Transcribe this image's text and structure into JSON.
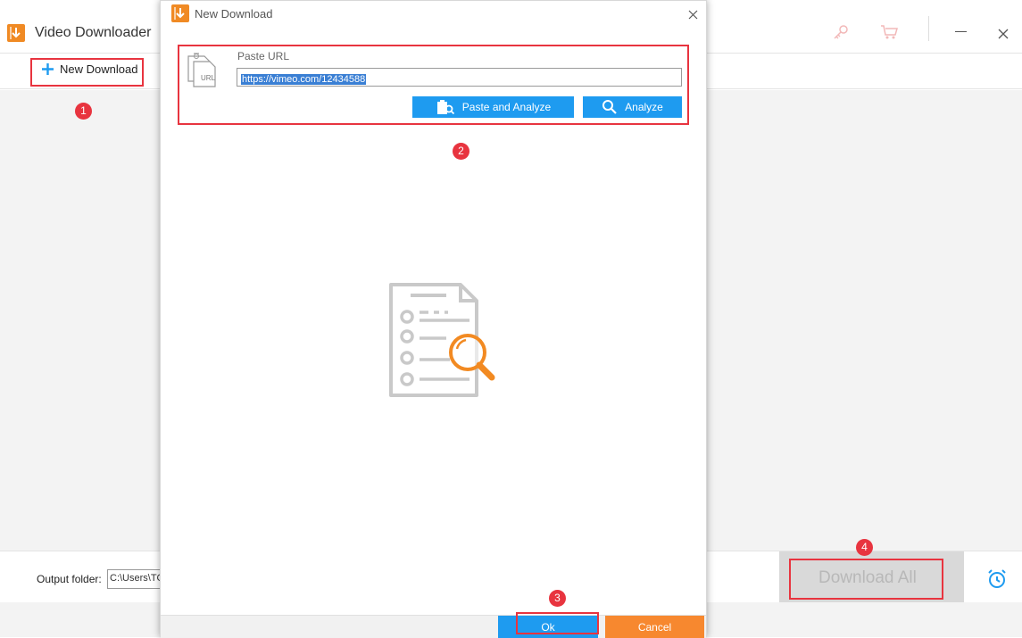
{
  "app": {
    "title": "Video Downloader",
    "toolbar": {
      "new_download_label": "New Download"
    },
    "footer": {
      "output_folder_label": "Output folder:",
      "output_folder_value": "C:\\Users\\TG",
      "download_all_label": "Download All"
    },
    "icons": [
      "key-icon",
      "cart-icon",
      "minimize-icon",
      "close-icon",
      "alarm-clock-icon"
    ]
  },
  "dialog": {
    "title": "New Download",
    "paste_url_label": "Paste URL",
    "url_value": "https://vimeo.com/12434588",
    "url_icon_text": "URL",
    "paste_and_analyze_label": "Paste and Analyze",
    "analyze_label": "Analyze",
    "ok_label": "Ok",
    "cancel_label": "Cancel"
  },
  "annotations": {
    "step1": "1",
    "step2": "2",
    "step3": "3",
    "step4": "4"
  },
  "colors": {
    "accent_blue": "#1e9bf0",
    "accent_orange": "#f08a24",
    "annotation_red": "#e8343f",
    "cancel_orange": "#f7882f"
  }
}
